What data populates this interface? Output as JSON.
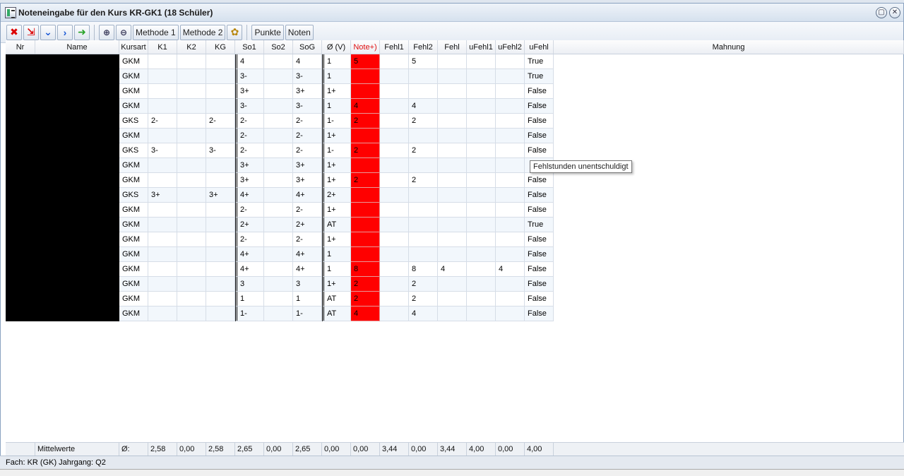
{
  "window": {
    "title": "Noteneingabe für den Kurs KR-GK1 (18 Schüler)"
  },
  "toolbar": {
    "methode1": "Methode 1",
    "methode2": "Methode 2",
    "punkte": "Punkte",
    "noten": "Noten"
  },
  "columns": [
    "Nr",
    "Name",
    "Kursart",
    "K1",
    "K2",
    "KG",
    "So1",
    "So2",
    "SoG",
    "Ø (V)",
    "Note+)",
    "Fehl1",
    "Fehl2",
    "Fehl",
    "uFehl1",
    "uFehl2",
    "uFehl",
    "Mahnung"
  ],
  "rows": [
    [
      "GKM",
      "",
      "",
      "",
      "4",
      "",
      "4",
      "1",
      "5",
      "",
      "5",
      "",
      "",
      "",
      "True"
    ],
    [
      "GKM",
      "",
      "",
      "",
      "3-",
      "",
      "3-",
      "1",
      "",
      "",
      "",
      "",
      "",
      "",
      "True"
    ],
    [
      "GKM",
      "",
      "",
      "",
      "3+",
      "",
      "3+",
      "1+",
      "",
      "",
      "",
      "",
      "",
      "",
      "False"
    ],
    [
      "GKM",
      "",
      "",
      "",
      "3-",
      "",
      "3-",
      "1",
      "4",
      "",
      "4",
      "",
      "",
      "",
      "False"
    ],
    [
      "GKS",
      "2-",
      "",
      "2-",
      "2-",
      "",
      "2-",
      "1-",
      "2",
      "",
      "2",
      "",
      "",
      "",
      "False"
    ],
    [
      "GKM",
      "",
      "",
      "",
      "2-",
      "",
      "2-",
      "1+",
      "",
      "",
      "",
      "",
      "",
      "",
      "False"
    ],
    [
      "GKS",
      "3-",
      "",
      "3-",
      "2-",
      "",
      "2-",
      "1-",
      "2",
      "",
      "2",
      "",
      "",
      "",
      "False"
    ],
    [
      "GKM",
      "",
      "",
      "",
      "3+",
      "",
      "3+",
      "1+",
      "",
      "",
      "",
      "",
      "",
      "",
      ""
    ],
    [
      "GKM",
      "",
      "",
      "",
      "3+",
      "",
      "3+",
      "1+",
      "2",
      "",
      "2",
      "",
      "",
      "",
      "False"
    ],
    [
      "GKS",
      "3+",
      "",
      "3+",
      "4+",
      "",
      "4+",
      "2+",
      "",
      "",
      "",
      "",
      "",
      "",
      "False"
    ],
    [
      "GKM",
      "",
      "",
      "",
      "2-",
      "",
      "2-",
      "1+",
      "",
      "",
      "",
      "",
      "",
      "",
      "False"
    ],
    [
      "GKM",
      "",
      "",
      "",
      "2+",
      "",
      "2+",
      "AT",
      "",
      "",
      "",
      "",
      "",
      "",
      "True"
    ],
    [
      "GKM",
      "",
      "",
      "",
      "2-",
      "",
      "2-",
      "1+",
      "",
      "",
      "",
      "",
      "",
      "",
      "False"
    ],
    [
      "GKM",
      "",
      "",
      "",
      "4+",
      "",
      "4+",
      "1",
      "",
      "",
      "",
      "",
      "",
      "",
      "False"
    ],
    [
      "GKM",
      "",
      "",
      "",
      "4+",
      "",
      "4+",
      "1",
      "8",
      "",
      "8",
      "4",
      "",
      "4",
      "False"
    ],
    [
      "GKM",
      "",
      "",
      "",
      "3",
      "",
      "3",
      "1+",
      "2",
      "",
      "2",
      "",
      "",
      "",
      "False"
    ],
    [
      "GKM",
      "",
      "",
      "",
      "1",
      "",
      "1",
      "AT",
      "2",
      "",
      "2",
      "",
      "",
      "",
      "False"
    ],
    [
      "GKM",
      "",
      "",
      "",
      "1-",
      "",
      "1-",
      "AT",
      "4",
      "",
      "4",
      "",
      "",
      "",
      "False"
    ]
  ],
  "tooltip": "Fehlstunden unentschuldigt",
  "footer": {
    "label": "Mittelwerte",
    "avg_symbol": "Ø:",
    "values": [
      "2,58",
      "0,00",
      "2,58",
      "2,65",
      "0,00",
      "2,65",
      "0,00",
      "0,00",
      "3,44",
      "0,00",
      "3,44",
      "4,00",
      "0,00",
      "4,00"
    ]
  },
  "status": "Fach: KR (GK) Jahrgang: Q2",
  "colors": {
    "note_cell": "#ff0000",
    "true_text": "#cc0000"
  }
}
